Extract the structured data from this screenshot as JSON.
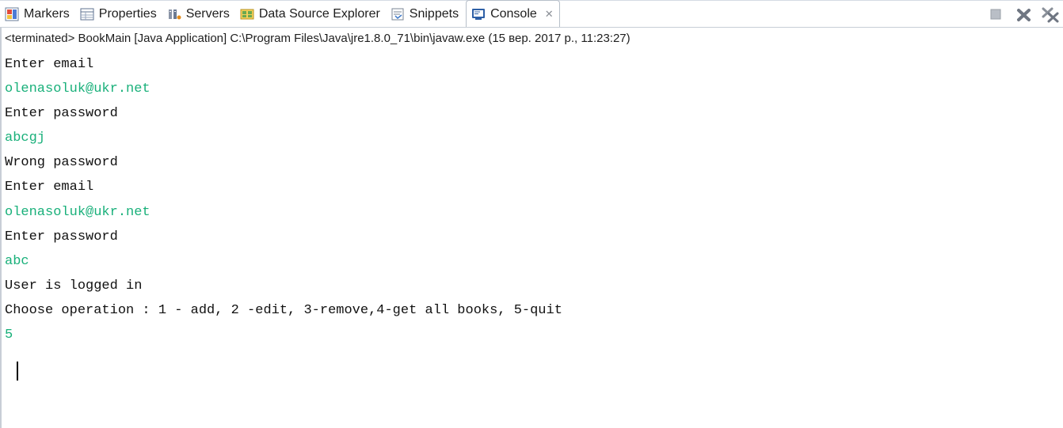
{
  "tabs": [
    {
      "label": "Markers",
      "icon": "markers-icon"
    },
    {
      "label": "Properties",
      "icon": "properties-icon"
    },
    {
      "label": "Servers",
      "icon": "servers-icon"
    },
    {
      "label": "Data Source Explorer",
      "icon": "data-source-explorer-icon"
    },
    {
      "label": "Snippets",
      "icon": "snippets-icon"
    },
    {
      "label": "Console",
      "icon": "console-icon",
      "active": true
    }
  ],
  "status_line": "<terminated> BookMain [Java Application] C:\\Program Files\\Java\\jre1.8.0_71\\bin\\javaw.exe (15 вер. 2017 р., 11:23:27)",
  "console_lines": [
    {
      "text": "Enter email",
      "kind": "output"
    },
    {
      "text": "olenasoluk@ukr.net",
      "kind": "input"
    },
    {
      "text": "Enter password",
      "kind": "output"
    },
    {
      "text": "abcgj",
      "kind": "input"
    },
    {
      "text": "Wrong password",
      "kind": "output"
    },
    {
      "text": "Enter email",
      "kind": "output"
    },
    {
      "text": "olenasoluk@ukr.net",
      "kind": "input"
    },
    {
      "text": "Enter password",
      "kind": "output"
    },
    {
      "text": "abc",
      "kind": "input"
    },
    {
      "text": "User is logged in",
      "kind": "output"
    },
    {
      "text": "Choose operation : 1 - add, 2 -edit, 3-remove,4-get all books, 5-quit",
      "kind": "output"
    },
    {
      "text": "5",
      "kind": "input"
    }
  ],
  "colors": {
    "input_text": "#19b07a",
    "output_text": "#111111"
  }
}
